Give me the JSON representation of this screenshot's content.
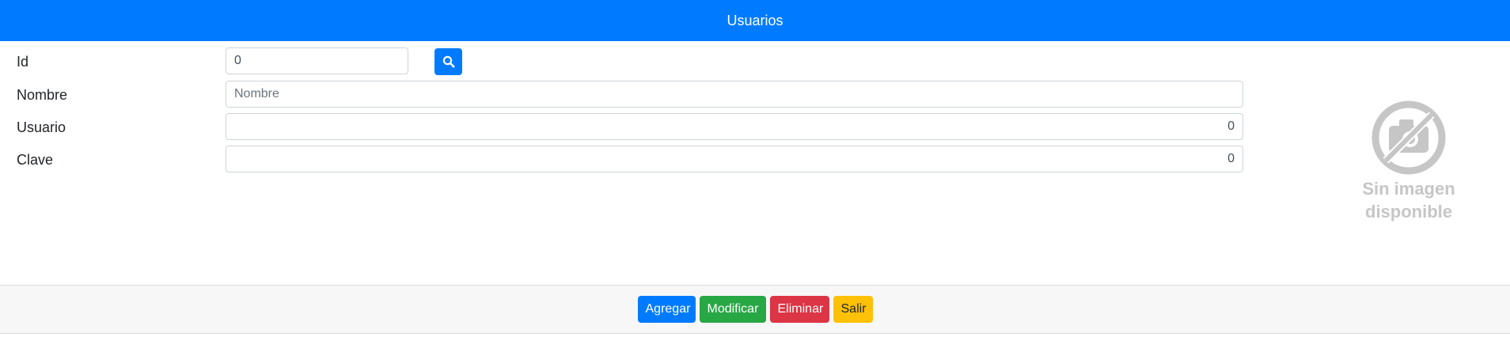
{
  "header": {
    "title": "Usuarios"
  },
  "form": {
    "fields": [
      {
        "label": "Id",
        "value": "0",
        "placeholder": ""
      },
      {
        "label": "Nombre",
        "value": "",
        "placeholder": "Nombre"
      },
      {
        "label": "Usuario",
        "value": "0",
        "placeholder": ""
      },
      {
        "label": "Clave",
        "value": "0",
        "placeholder": ""
      }
    ],
    "search_icon": "search-icon"
  },
  "image_placeholder": {
    "icon": "no-camera-icon",
    "line1": "Sin imagen",
    "line2": "disponible"
  },
  "footer": {
    "buttons": [
      {
        "label": "Agregar",
        "color": "#007bff"
      },
      {
        "label": "Modificar",
        "color": "#28a745"
      },
      {
        "label": "Eliminar",
        "color": "#dc3545"
      },
      {
        "label": "Salir",
        "color": "#ffc107"
      }
    ]
  },
  "colors": {
    "header_bg": "#007bff",
    "placeholder_gray": "#c6c6c6"
  }
}
